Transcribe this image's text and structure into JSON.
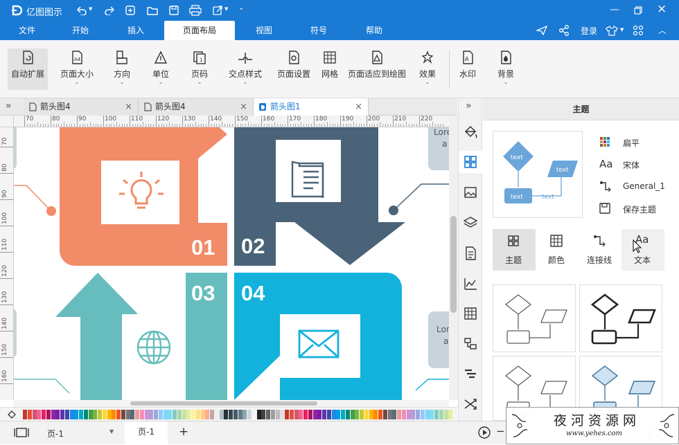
{
  "app": {
    "title": "亿图图示"
  },
  "menu": {
    "tabs": [
      "文件",
      "开始",
      "插入",
      "页面布局",
      "视图",
      "符号",
      "帮助"
    ],
    "active": "页面布局",
    "login": "登录"
  },
  "ribbon": {
    "buttons": [
      {
        "label": "自动扩展",
        "dropdown": false,
        "icon": "auto-extend-icon"
      },
      {
        "label": "页面大小",
        "dropdown": true,
        "icon": "page-size-icon"
      },
      {
        "label": "方向",
        "dropdown": true,
        "icon": "orientation-icon"
      },
      {
        "label": "单位",
        "dropdown": true,
        "icon": "unit-icon"
      },
      {
        "label": "页码",
        "dropdown": true,
        "icon": "page-number-icon"
      },
      {
        "label": "交点样式",
        "dropdown": true,
        "icon": "intersection-style-icon"
      },
      {
        "label": "页面设置",
        "dropdown": false,
        "icon": "page-setup-icon"
      },
      {
        "label": "网格",
        "dropdown": false,
        "icon": "grid-icon"
      },
      {
        "label": "页面适应到绘图",
        "dropdown": false,
        "icon": "fit-page-icon"
      },
      {
        "label": "效果",
        "dropdown": true,
        "icon": "effects-icon"
      },
      {
        "label": "水印",
        "dropdown": false,
        "icon": "watermark-icon"
      },
      {
        "label": "背景",
        "dropdown": true,
        "icon": "background-icon"
      }
    ]
  },
  "doc_tabs": [
    {
      "label": "箭头图4",
      "active": false
    },
    {
      "label": "箭头图4",
      "active": false
    },
    {
      "label": "箭头图1",
      "active": true
    }
  ],
  "ruler": {
    "h": [
      "70",
      "80",
      "90",
      "100",
      "110",
      "120",
      "130",
      "140",
      "150",
      "160",
      "170",
      "180",
      "190",
      "200",
      "210",
      "220"
    ],
    "v": [
      "70",
      "80",
      "90",
      "100",
      "110",
      "120",
      "130",
      "140",
      "150",
      "160"
    ]
  },
  "canvas": {
    "num1": "01",
    "num2": "02",
    "num3": "03",
    "num4": "04",
    "lorem": "Lore",
    "lorem2": "a",
    "colors": {
      "orange": "#f28b68",
      "slate": "#4a6378",
      "teal": "#67bdbd",
      "cyan": "#12b2dc",
      "gray": "#c8d3db"
    }
  },
  "panel": {
    "title": "主题",
    "preview": {
      "text1": "text",
      "text2": "text",
      "text3": "text",
      "text4": "text"
    },
    "options": [
      {
        "label": "扁平",
        "icon": "palette-icon"
      },
      {
        "label": "宋体",
        "icon": "font-icon"
      },
      {
        "label": "General_1",
        "icon": "connector-icon"
      },
      {
        "label": "保存主题",
        "icon": "save-icon"
      }
    ],
    "tabs": [
      {
        "label": "主题",
        "icon": "theme-grid-icon",
        "active": true
      },
      {
        "label": "颜色",
        "icon": "color-grid-icon",
        "active": false
      },
      {
        "label": "连接线",
        "icon": "connector-icon",
        "active": false
      },
      {
        "label": "文本",
        "icon": "text-icon",
        "active": false
      }
    ]
  },
  "status": {
    "page_select": "页-1",
    "page_tab": "页-1",
    "add": "+",
    "minus": "−"
  },
  "watermark": {
    "site": "夜河资源网",
    "url": "www.yehes.com"
  }
}
